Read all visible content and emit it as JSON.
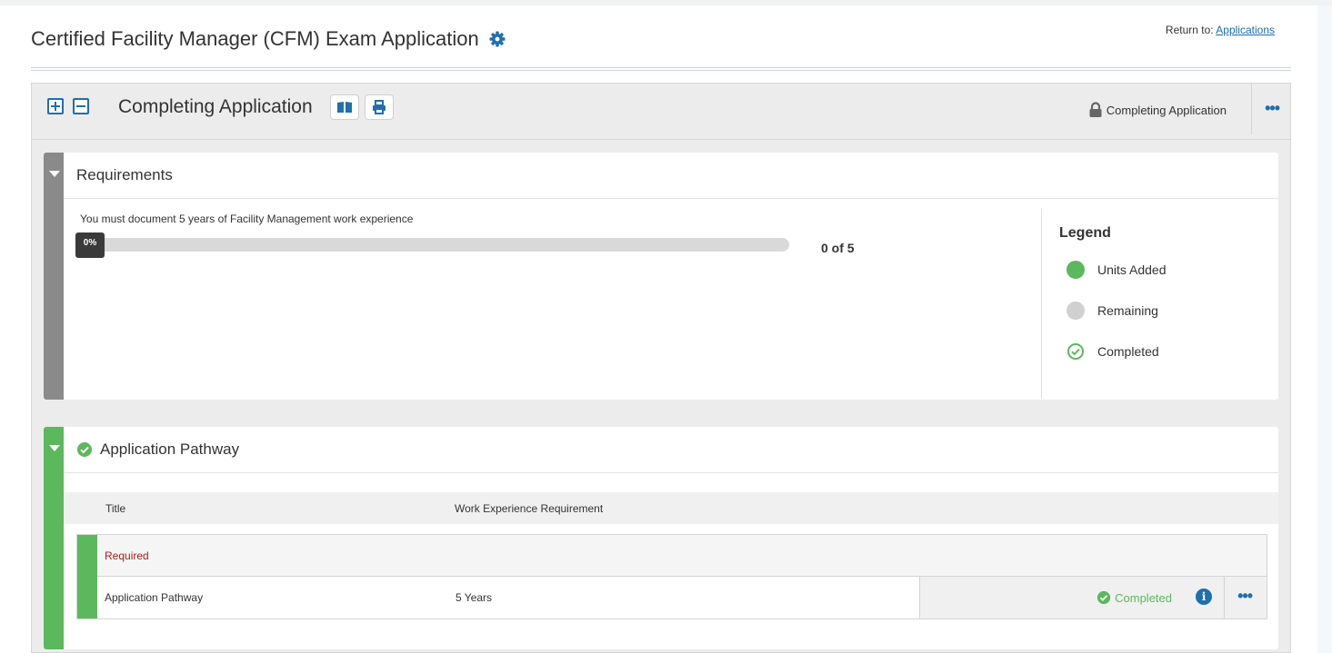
{
  "page": {
    "title": "Certified Facility Manager (CFM) Exam Application",
    "return_prefix": "Return to:",
    "return_link": "Applications"
  },
  "section": {
    "title": "Completing Application",
    "status": "Completing Application",
    "icons": [
      "expand-all-icon",
      "collapse-all-icon",
      "book-icon",
      "print-icon",
      "lock-icon",
      "more-options-icon"
    ]
  },
  "requirements": {
    "title": "Requirements",
    "text": "You must document 5 years of Facility Management work experience",
    "progress": 0,
    "progress_label": "0%",
    "count": "0 of 5",
    "legend": {
      "title": "Legend",
      "items": [
        {
          "label": "Units Added",
          "color": "#5cb85c"
        },
        {
          "label": "Remaining",
          "color": "#d0d0d0"
        },
        {
          "label": "Completed",
          "color": "#5cb85c"
        }
      ]
    },
    "bar_color": "#8a8a8a"
  },
  "pathway": {
    "title": "Application Pathway",
    "bar_color": "#5cb85c",
    "columns": [
      "Title",
      "Work Experience Requirement"
    ],
    "group_label": "Required",
    "rows": [
      {
        "title": "Application Pathway",
        "requirement": "5 Years",
        "status": "Completed"
      }
    ]
  },
  "colors": {
    "accent": "#1f6fad",
    "success": "#5cb85c",
    "required": "#a8201a"
  }
}
